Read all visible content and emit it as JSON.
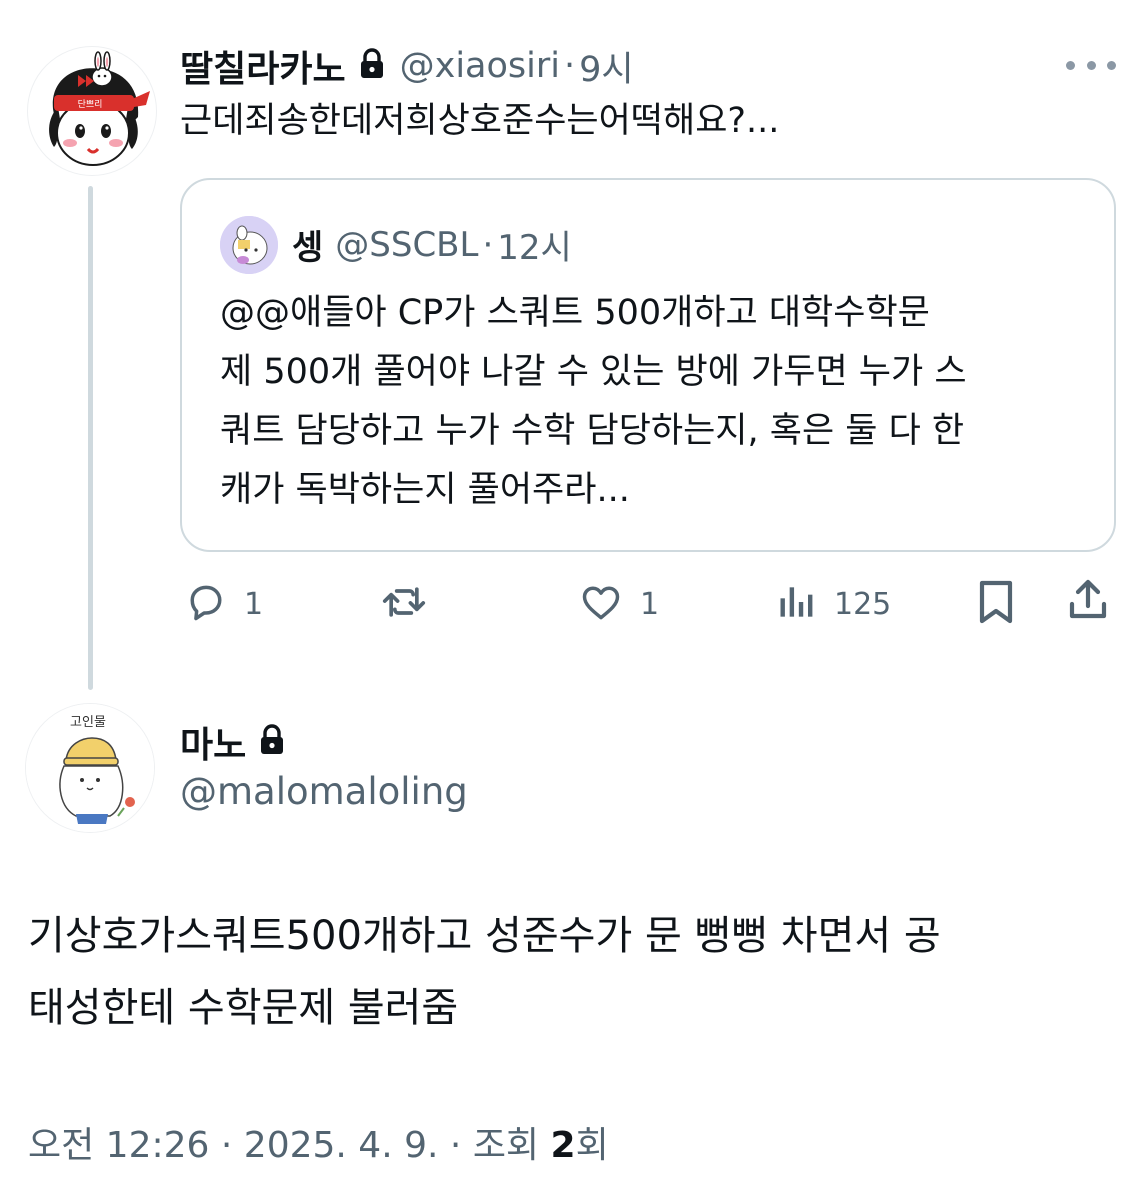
{
  "quoter": {
    "display_name": "딸칠라카노",
    "handle": "@xiaosiri",
    "separator": "·",
    "time": "9시",
    "text": "근데죄송한데저희상호준수는어떡해요?...",
    "avatar_text": "단쁘리",
    "icons": {
      "lock": "lock-icon",
      "more": "more-dots-icon"
    }
  },
  "quoted": {
    "display_name": "셍",
    "handle": "@SSCBL",
    "separator": "·",
    "time": "12시",
    "lines": [
      "@@애들아 CP가 스쿼트 500개하고 대학수학문",
      "제 500개 풀어야 나갈 수 있는 방에 가두면 누가 스",
      "쿼트 담당하고 누가 수학 담당하는지, 혹은 둘 다 한",
      "캐가 독박하는지 풀어주라..."
    ]
  },
  "actions": {
    "reply_count": "1",
    "retweet_count": "",
    "like_count": "1",
    "views_count": "125"
  },
  "author": {
    "display_name": "마노",
    "handle": "@malomaloling",
    "avatar_text": "고인물",
    "text_lines": [
      "기상호가스쿼트500개하고 성준수가 문 뻥뻥 차면서 공",
      "태성한테 수학문제 불러줌"
    ]
  },
  "meta": {
    "time": "오전 12:26",
    "separator": "·",
    "date": "2025. 4. 9.",
    "views_label": "조회",
    "views_count": "2",
    "views_suffix": "회"
  },
  "colors": {
    "text": "#0f1419",
    "secondary": "#536471",
    "border": "#cfd9de",
    "headband": "#d9302c"
  }
}
